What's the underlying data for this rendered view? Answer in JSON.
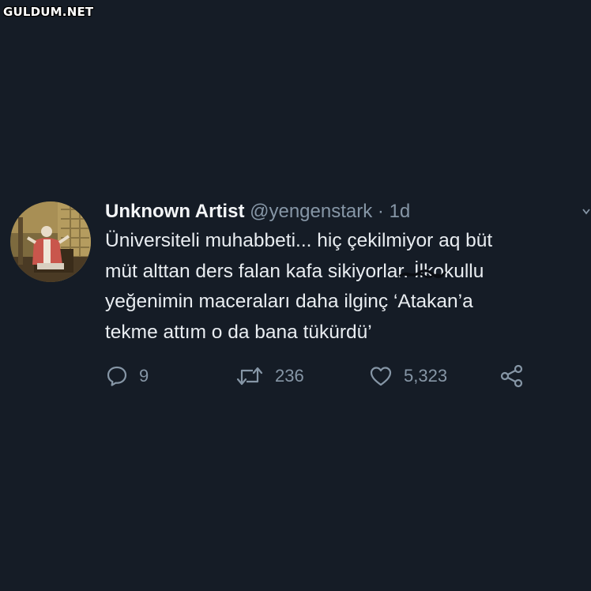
{
  "watermark": {
    "text": "GULDUM.NET"
  },
  "tweet": {
    "author_name": "Unknown Artist",
    "handle": "@yengenstark",
    "separator": "·",
    "time": "1d",
    "body_lines": [
      "Üniversiteli muhabbeti... hiç çekilmiyor aq büt",
      "müt alttan ders falan kafa sikiyorlar. İlkokullu",
      "yeğenimin maceraları daha ilginç ‘Atakan’a",
      "tekme attım o da bana tükürdü’"
    ],
    "actions": {
      "reply": {
        "icon": "reply-icon",
        "count": "9"
      },
      "retweet": {
        "icon": "retweet-icon",
        "count": "236"
      },
      "like": {
        "icon": "heart-icon",
        "count": "5,323"
      },
      "share": {
        "icon": "share-icon"
      }
    }
  },
  "colors": {
    "background": "#151c26",
    "text": "#e9edf1",
    "muted": "#8696a6"
  }
}
